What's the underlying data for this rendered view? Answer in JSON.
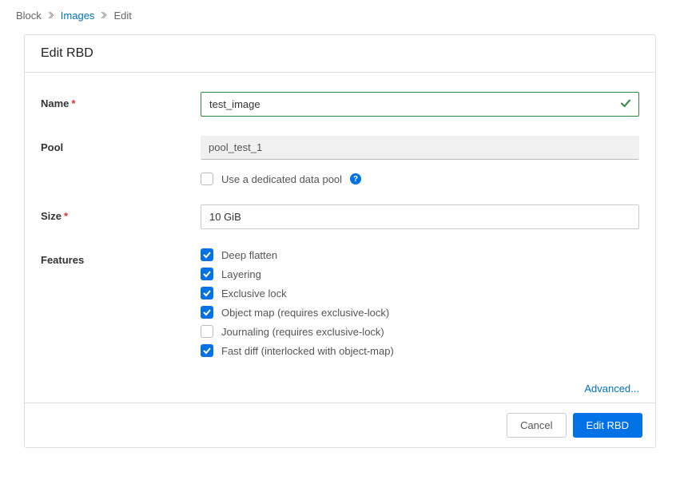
{
  "breadcrumb": {
    "block": "Block",
    "images": "Images",
    "edit": "Edit"
  },
  "card": {
    "title": "Edit RBD"
  },
  "form": {
    "name_label": "Name",
    "name_value": "test_image",
    "pool_label": "Pool",
    "pool_value": "pool_test_1",
    "dedicated_label": "Use a dedicated data pool",
    "size_label": "Size",
    "size_value": "10 GiB",
    "features_label": "Features",
    "features": [
      {
        "label": "Deep flatten",
        "checked": true
      },
      {
        "label": "Layering",
        "checked": true
      },
      {
        "label": "Exclusive lock",
        "checked": true
      },
      {
        "label": "Object map (requires exclusive-lock)",
        "checked": true
      },
      {
        "label": "Journaling (requires exclusive-lock)",
        "checked": false
      },
      {
        "label": "Fast diff (interlocked with object-map)",
        "checked": true
      }
    ],
    "advanced_label": "Advanced..."
  },
  "footer": {
    "cancel": "Cancel",
    "submit": "Edit RBD"
  }
}
